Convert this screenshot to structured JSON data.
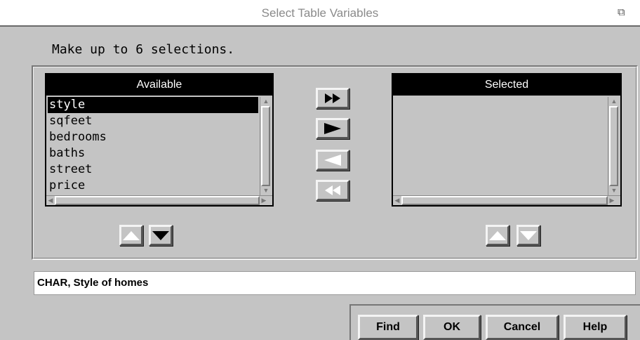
{
  "window": {
    "title": "Select Table Variables",
    "corner_icon": "restore-icon"
  },
  "instruction": "Make up to 6 selections.",
  "available": {
    "header": "Available",
    "items": [
      "style",
      "sqfeet",
      "bedrooms",
      "baths",
      "street",
      "price"
    ],
    "selected_item": "style"
  },
  "selected": {
    "header": "Selected",
    "items": []
  },
  "transfer_buttons": {
    "add_all": "double-right-arrow-icon",
    "add": "right-arrow-icon",
    "remove": "left-arrow-icon",
    "remove_all": "double-left-arrow-icon"
  },
  "info_text": "CHAR, Style of homes",
  "buttons": {
    "find": "Find",
    "ok": "OK",
    "cancel": "Cancel",
    "help": "Help"
  },
  "colors": {
    "dialog_bg": "#c4c4c4",
    "header_bg": "#000000",
    "header_text": "#ffffff"
  }
}
